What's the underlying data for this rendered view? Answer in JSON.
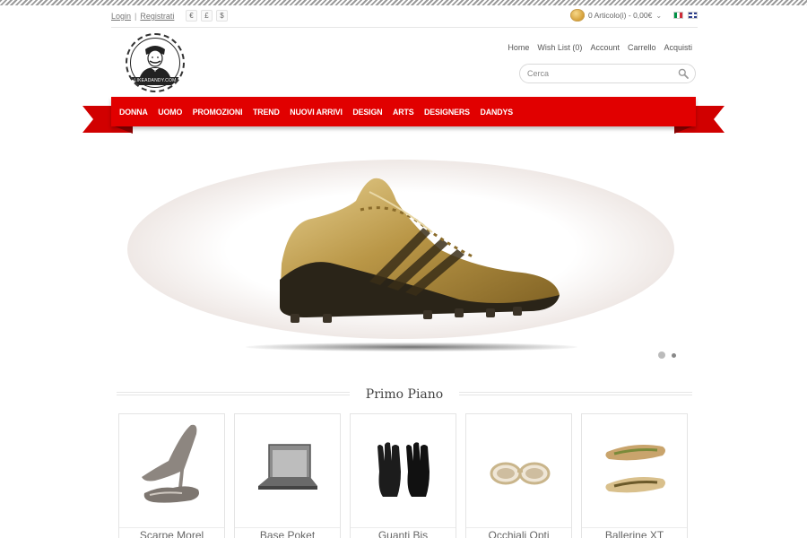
{
  "header": {
    "login": "Login",
    "register": "Registrati",
    "separator": "|",
    "currencies": [
      "€",
      "£",
      "$"
    ],
    "cart_summary": "0 Articolo(i) - 0,00€",
    "languages": [
      "italian-flag",
      "english-flag"
    ]
  },
  "logo": {
    "text": "LIKEADANDY.COM"
  },
  "nav_links": [
    "Home",
    "Wish List (0)",
    "Account",
    "Carrello",
    "Acquisti"
  ],
  "search": {
    "placeholder": "Cerca"
  },
  "main_menu": [
    "DONNA",
    "UOMO",
    "PROMOZIONI",
    "TREND",
    "NUOVI ARRIVI",
    "DESIGN",
    "ARTS",
    "DESIGNERS",
    "DANDYS"
  ],
  "slider": {
    "image": "golden-football-cleat",
    "dots": 2,
    "active_dot": 1
  },
  "featured": {
    "title": "Primo Piano",
    "products": [
      {
        "name": "Scarpe Morel",
        "image": "grey-high-heels"
      },
      {
        "name": "Base Poket",
        "image": "laptop-stand"
      },
      {
        "name": "Guanti Bis",
        "image": "black-gloves"
      },
      {
        "name": "Occhiali Opti",
        "image": "white-sunglasses"
      },
      {
        "name": "Ballerine XT",
        "image": "ballet-flats"
      }
    ]
  },
  "colors": {
    "ribbon": "#e10000",
    "ribbon_dark": "#8d0000",
    "text": "#666666"
  }
}
